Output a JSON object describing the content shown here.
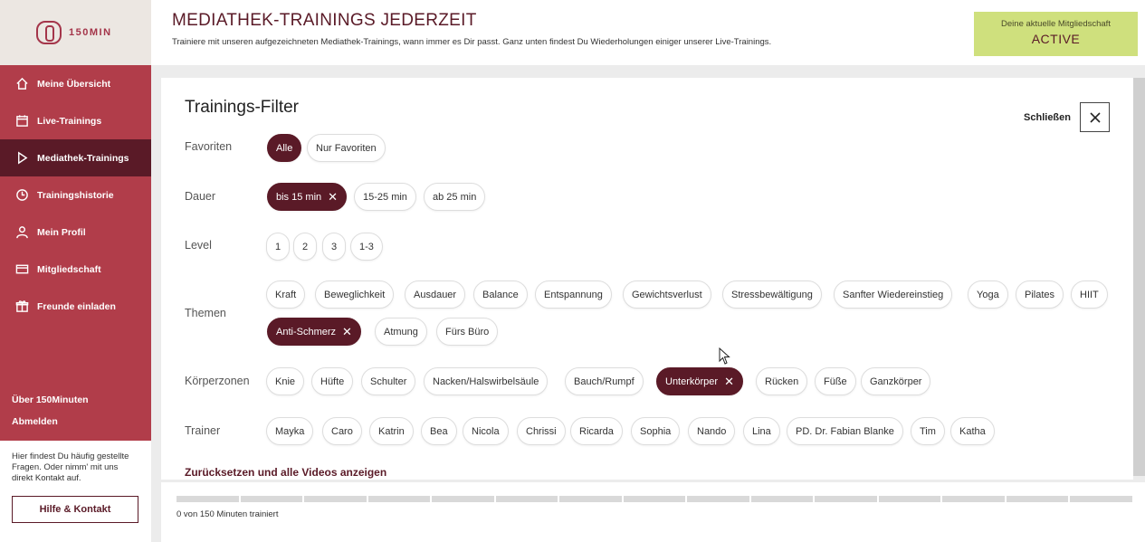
{
  "brand": {
    "logo_text": "150MIN"
  },
  "sidebar": {
    "items": [
      {
        "label": "Meine Übersicht",
        "icon": "home-icon"
      },
      {
        "label": "Live-Trainings",
        "icon": "calendar-icon"
      },
      {
        "label": "Mediathek-Trainings",
        "icon": "play-icon"
      },
      {
        "label": "Trainingshistorie",
        "icon": "clock-icon"
      },
      {
        "label": "Mein Profil",
        "icon": "user-icon"
      },
      {
        "label": "Mitgliedschaft",
        "icon": "card-icon"
      },
      {
        "label": "Freunde einladen",
        "icon": "gift-icon"
      }
    ],
    "about": "Über 150Minuten",
    "logout": "Abmelden",
    "help_text": "Hier findest Du häufig gestellte Fragen. Oder nimm' mit uns direkt Kontakt auf.",
    "help_button": "Hilfe & Kontakt"
  },
  "header": {
    "title": "MEDIATHEK-TRAININGS JEDERZEIT",
    "subtitle": "Trainiere mit unseren aufgezeichneten Mediathek-Trainings, wann immer es Dir passt. Ganz unten findest Du Wiederholungen einiger unserer Live-Trainings.",
    "membership_label": "Deine aktuelle Mitgliedschaft",
    "membership_status": "ACTIVE"
  },
  "filter": {
    "title": "Trainings-Filter",
    "close_label": "Schließen",
    "favorites": {
      "label": "Favoriten",
      "options": [
        "Alle",
        "Nur Favoriten"
      ]
    },
    "duration": {
      "label": "Dauer",
      "options": [
        "bis 15 min",
        "15-25 min",
        "ab 25 min"
      ]
    },
    "level": {
      "label": "Level",
      "options": [
        "1",
        "2",
        "3",
        "1-3"
      ]
    },
    "themes": {
      "label": "Themen",
      "options": [
        "Kraft",
        "Beweglichkeit",
        "Ausdauer",
        "Balance",
        "Entspannung",
        "Gewichtsverlust",
        "Stressbewältigung",
        "Sanfter Wiedereinstieg",
        "Yoga",
        "Pilates",
        "HIIT",
        "Anti-Schmerz",
        "Atmung",
        "Fürs Büro"
      ]
    },
    "zones": {
      "label": "Körperzonen",
      "options": [
        "Knie",
        "Hüfte",
        "Schulter",
        "Nacken/Halswirbelsäule",
        "Bauch/Rumpf",
        "Unterkörper",
        "Rücken",
        "Füße",
        "Ganzkörper"
      ]
    },
    "trainers": {
      "label": "Trainer",
      "options": [
        "Mayka",
        "Caro",
        "Katrin",
        "Bea",
        "Nicola",
        "Chrissi",
        "Ricarda",
        "Sophia",
        "Nando",
        "Lina",
        "PD. Dr. Fabian Blanke",
        "Tim",
        "Katha"
      ]
    },
    "reset": "Zurücksetzen und alle Videos anzeigen"
  },
  "progress": {
    "text": "0 von 150 Minuten trainiert",
    "value": 0
  },
  "colors": {
    "primary": "#b13d4a",
    "dark": "#5a1a27",
    "accent": "#cfe07d"
  }
}
